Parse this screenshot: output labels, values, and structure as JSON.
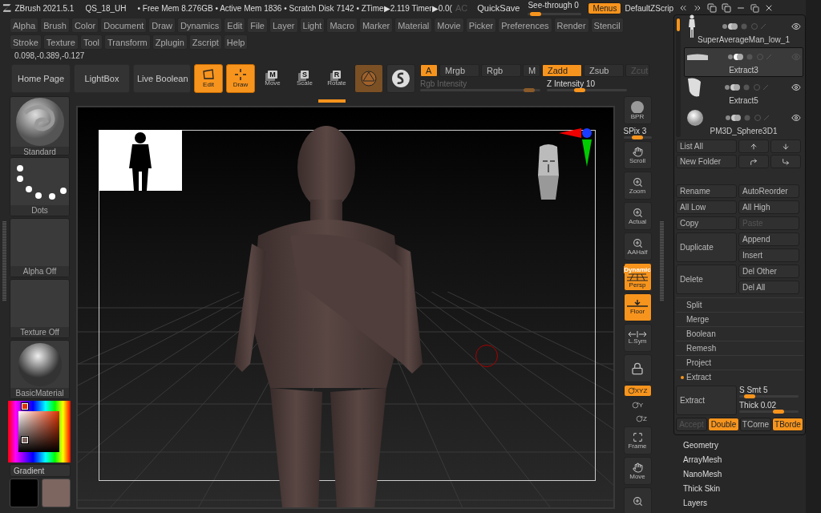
{
  "title_bar": {
    "app": "ZBrush 2021.5.1",
    "file": "QS_18_UH",
    "stats": "• Free Mem 8.276GB • Active Mem 1836 • Scratch Disk 7142 • ZTime▶2.119 Timer▶0.0(",
    "ac": {
      "label": "AC",
      "disabled": true
    },
    "quicksave": "QuickSave",
    "see_through": {
      "label": "See-through",
      "value": "0",
      "level": 0.05
    },
    "menus": {
      "label": "Menus",
      "selected": true
    },
    "script": "DefaultZScrip"
  },
  "menu_rows": [
    [
      "Alpha",
      "Brush",
      "Color",
      "Document",
      "Draw",
      "Dynamics",
      "Edit",
      "File",
      "Layer",
      "Light",
      "Macro",
      "Marker",
      "Material",
      "Movie",
      "Picker",
      "Preferences",
      "Render",
      "Stencil"
    ],
    [
      "Stroke",
      "Texture",
      "Tool",
      "Transform",
      "Zplugin",
      "Zscript",
      "Help"
    ]
  ],
  "coordinates": "0.098,-0.389,-0.127",
  "toolbar": {
    "nav_buttons": [
      "Home Page",
      "LightBox",
      "Live Boolean"
    ],
    "tools": [
      {
        "kind": "edit",
        "label": "Edit",
        "selected": true
      },
      {
        "kind": "draw",
        "label": "Draw",
        "selected": true
      },
      {
        "kind": "move",
        "label": "Move",
        "key": "M",
        "selected": false
      },
      {
        "kind": "scale",
        "label": "Scale",
        "key": "S",
        "selected": false
      },
      {
        "kind": "rotate",
        "label": "Rotate",
        "key": "R",
        "selected": false
      },
      {
        "kind": "material",
        "selected": true
      },
      {
        "kind": "sculptris",
        "selected": false
      }
    ],
    "modes": [
      {
        "label": "A",
        "selected": true,
        "disabled": false
      },
      {
        "label": "Mrgb",
        "selected": false,
        "disabled": false
      },
      {
        "label": "Rgb",
        "selected": false,
        "disabled": false
      },
      {
        "label": "M",
        "selected": false,
        "disabled": false
      },
      {
        "label": "Zadd",
        "selected": true,
        "disabled": false
      },
      {
        "label": "Zsub",
        "selected": false,
        "disabled": false
      },
      {
        "label": "Zcut",
        "selected": false,
        "disabled": true
      }
    ],
    "sliders": [
      {
        "label": "Rgb Intensity",
        "disabled": true,
        "level": 0.95
      },
      {
        "label": "Z Intensity",
        "value": "10",
        "disabled": false,
        "level": 0.4
      }
    ]
  },
  "left_panel": {
    "tiles": [
      {
        "kind": "brush",
        "label": "Standard"
      },
      {
        "kind": "stroke",
        "label": "Dots"
      },
      {
        "kind": "empty",
        "label": "Alpha Off"
      },
      {
        "kind": "empty",
        "label": "Texture Off"
      },
      {
        "kind": "material",
        "label": "BasicMaterial"
      }
    ],
    "gradient": "Gradient",
    "swatches": [
      {
        "color": "#000000"
      },
      {
        "color": "#7d6560"
      }
    ]
  },
  "right_tools": [
    {
      "kind": "bpr",
      "label": "BPR"
    },
    {
      "kind": "spix",
      "label": "SPix",
      "value": "3",
      "level": 0.5
    },
    {
      "kind": "scroll",
      "label": "Scroll",
      "on": false
    },
    {
      "kind": "zoom",
      "label": "Zoom",
      "on": false
    },
    {
      "kind": "actual",
      "label": "Actual",
      "on": false
    },
    {
      "kind": "aahalf",
      "label": "AAHalf",
      "on": false
    },
    {
      "kind": "persp",
      "label": "Persp",
      "caption": "Dynamic",
      "on": true
    },
    {
      "kind": "floor",
      "label": "Floor",
      "on": true
    },
    {
      "kind": "lsym",
      "label": "L.Sym",
      "on": false
    },
    {
      "kind": "lock",
      "on": false
    },
    {
      "kind": "xyz",
      "label": "XYZ",
      "on": true
    },
    {
      "kind": "y",
      "label": "Y",
      "on": false
    },
    {
      "kind": "z",
      "label": "Z",
      "on": false
    },
    {
      "kind": "frame",
      "label": "Frame",
      "on": false
    },
    {
      "kind": "move",
      "label": "Move",
      "on": false
    },
    {
      "kind": "zoomcut",
      "on": false
    }
  ],
  "subtools": [
    {
      "kind": "figure",
      "name": "SuperAverageMan_low_1",
      "selected": false
    },
    {
      "kind": "slab",
      "name": "Extract3",
      "selected": true
    },
    {
      "kind": "cloth",
      "name": "Extract5",
      "selected": false
    },
    {
      "kind": "sphere",
      "name": "PM3D_Sphere3D1",
      "selected": false
    }
  ],
  "subtool_buttons": {
    "list_all": "List All",
    "new_folder": "New Folder"
  },
  "action_rows": [
    [
      {
        "label": "Rename",
        "disabled": false
      },
      {
        "label": "AutoReorder",
        "disabled": false
      }
    ],
    [
      {
        "label": "All Low",
        "disabled": false
      },
      {
        "label": "All High",
        "disabled": false
      }
    ],
    [
      {
        "label": "Copy",
        "disabled": false
      },
      {
        "label": "Paste",
        "disabled": true
      }
    ]
  ],
  "duplicate": {
    "label": "Duplicate",
    "side": [
      "Append",
      "Insert"
    ]
  },
  "delete": {
    "label": "Delete",
    "side": [
      "Del Other",
      "Del All"
    ]
  },
  "sections": [
    {
      "label": "Split",
      "expanded": false
    },
    {
      "label": "Merge",
      "expanded": false
    },
    {
      "label": "Boolean",
      "expanded": false
    },
    {
      "label": "Remesh",
      "expanded": false
    },
    {
      "label": "Project",
      "expanded": false
    },
    {
      "label": "Extract",
      "expanded": true
    }
  ],
  "extract": {
    "button": "Extract",
    "smt": {
      "label": "S Smt",
      "value": "5",
      "level": 0.1
    },
    "thick": {
      "label": "Thick",
      "value": "0.02",
      "level": 0.7
    },
    "toggles": [
      {
        "label": "Accept",
        "selected": false,
        "disabled": true
      },
      {
        "label": "Double",
        "selected": true,
        "disabled": false
      },
      {
        "label": "TCorne",
        "selected": false,
        "disabled": false
      },
      {
        "label": "TBorde",
        "selected": true,
        "disabled": false
      }
    ]
  },
  "palettes": [
    "Geometry",
    "ArrayMesh",
    "NanoMesh",
    "Thick Skin",
    "Layers"
  ]
}
